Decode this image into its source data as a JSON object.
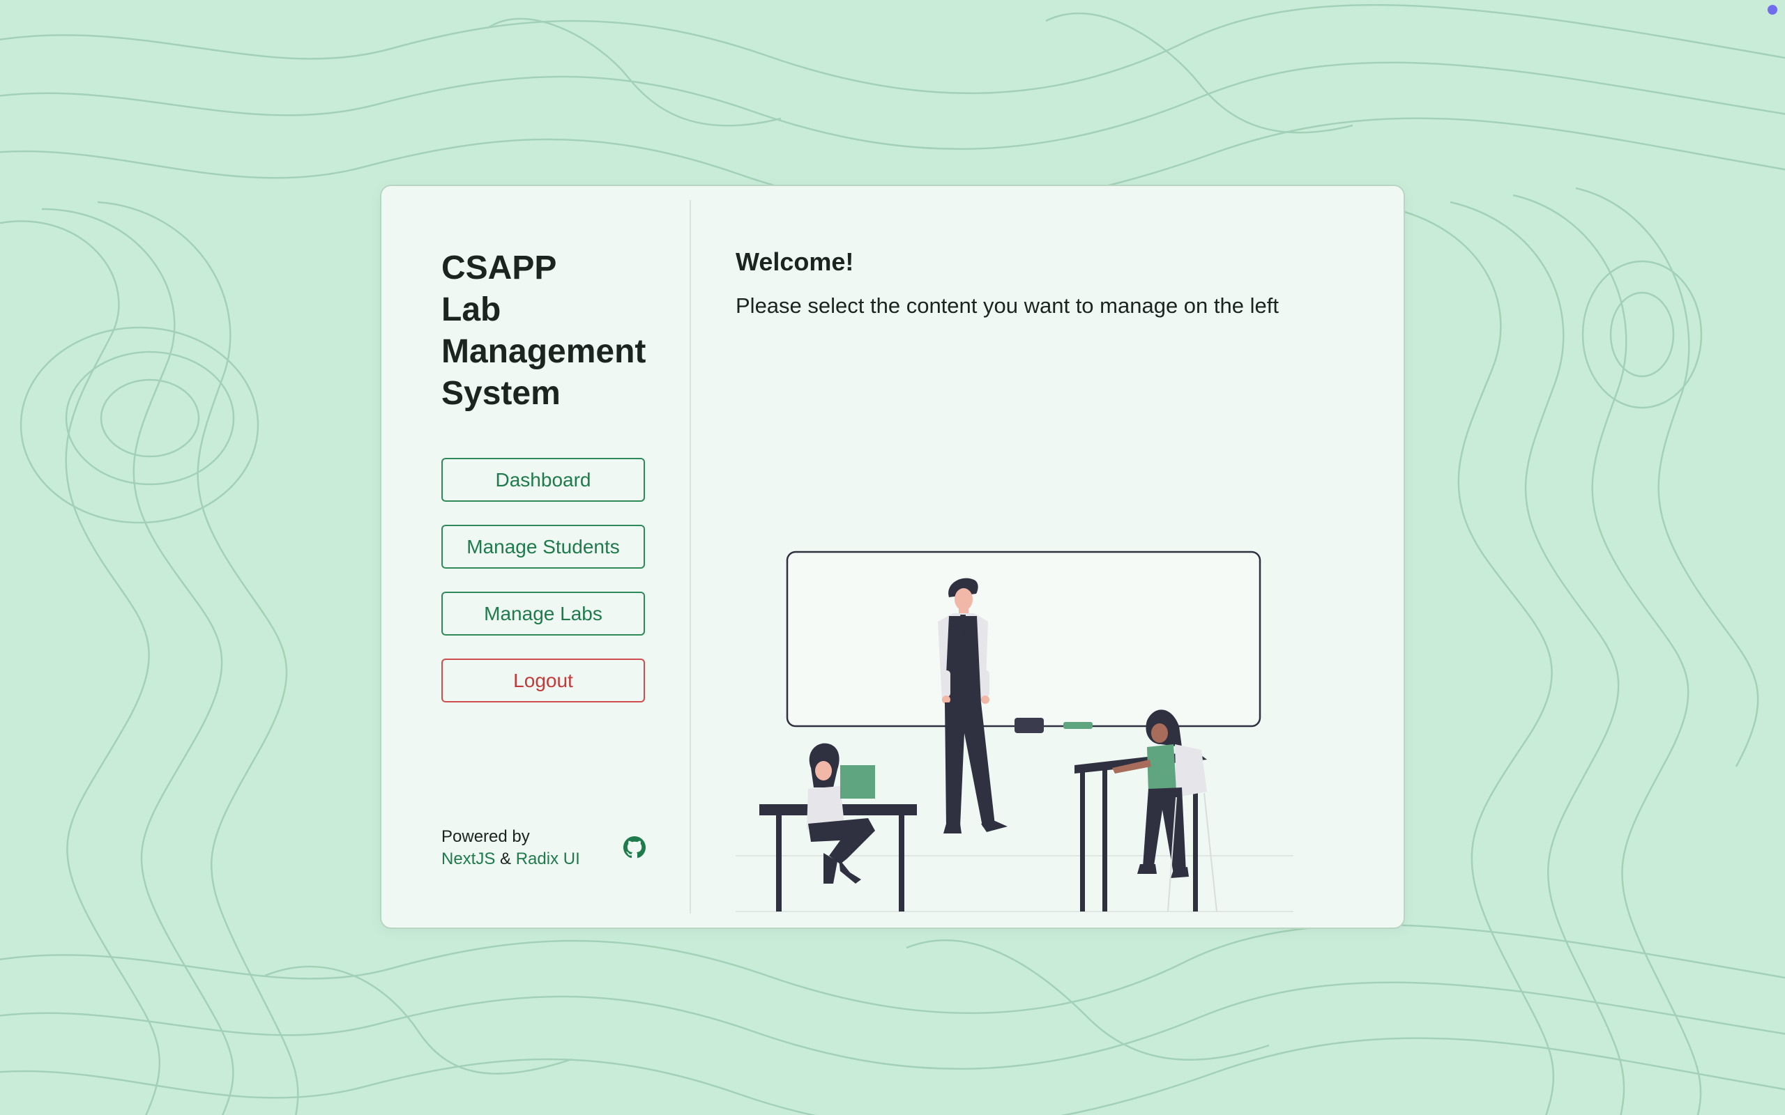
{
  "app": {
    "title_lines": [
      "CSAPP",
      "Lab",
      "Management",
      "System"
    ]
  },
  "nav": {
    "dashboard_label": "Dashboard",
    "students_label": "Manage Students",
    "labs_label": "Manage Labs",
    "logout_label": "Logout"
  },
  "footer": {
    "powered_by": "Powered by",
    "nextjs_label": "NextJS",
    "and_label": "&",
    "radix_label": "Radix UI",
    "github_icon": "github-icon"
  },
  "main": {
    "heading": "Welcome!",
    "subtitle": "Please select the content you want to manage on the left"
  },
  "colors": {
    "background": "#c9ecd8",
    "accent": "#1f7a4c",
    "danger": "#c23a3a",
    "card": "#eff8f2"
  }
}
